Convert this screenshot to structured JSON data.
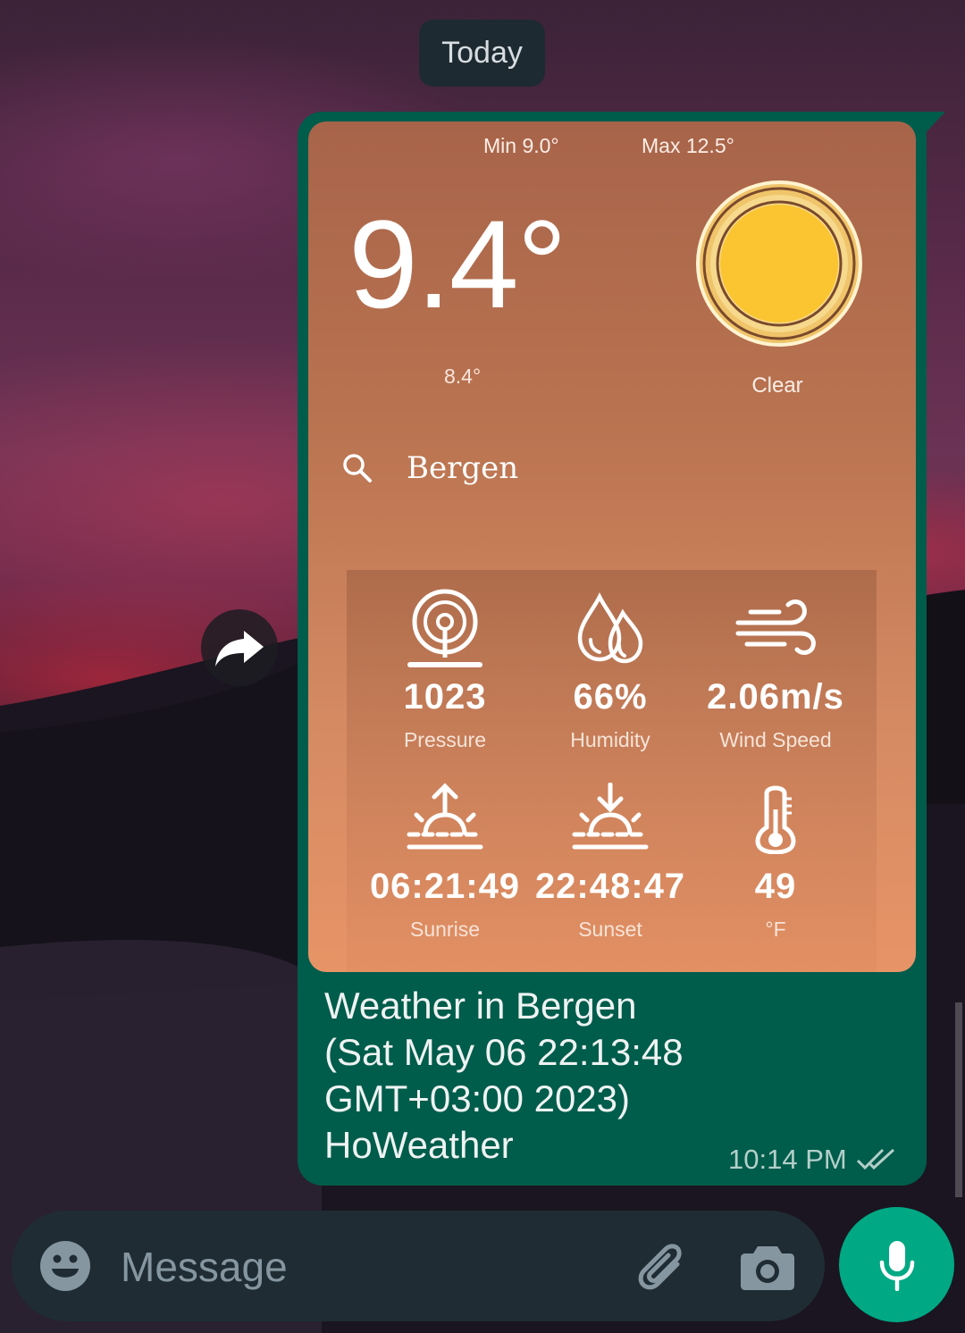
{
  "date_chip": "Today",
  "weather_card": {
    "min": "Min 9.0°",
    "max": "Max 12.5°",
    "temperature": "9.4°",
    "feels_like": "8.4°",
    "condition": "Clear",
    "condition_icon": "sun-icon",
    "city": "Bergen",
    "stats": [
      {
        "icon": "pressure-gauge-icon",
        "value": "1023",
        "label": "Pressure"
      },
      {
        "icon": "humidity-drops-icon",
        "value": "66%",
        "label": "Humidity"
      },
      {
        "icon": "wind-icon",
        "value": "2.06m/s",
        "label": "Wind Speed"
      },
      {
        "icon": "sunrise-icon",
        "value": "06:21:49",
        "label": "Sunrise"
      },
      {
        "icon": "sunset-icon",
        "value": "22:48:47",
        "label": "Sunset"
      },
      {
        "icon": "thermometer-icon",
        "value": "49",
        "label": "°F"
      }
    ]
  },
  "caption_lines": [
    "Weather in Bergen",
    "(Sat May 06 22:13:48",
    "GMT+03:00 2023)",
    "HoWeather"
  ],
  "message_time": "10:14 PM",
  "message_status": "read-double-check-icon",
  "composer": {
    "placeholder": "Message"
  },
  "colors": {
    "bubble": "#005c4b",
    "accent": "#00a884",
    "input_bar": "#1f2c34",
    "card_top": "#a8644a",
    "card_bottom": "#e79467",
    "sun": "#fbc531"
  }
}
